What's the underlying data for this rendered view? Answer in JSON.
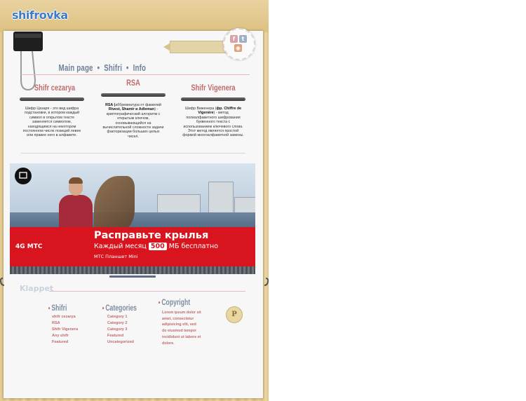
{
  "site": {
    "logo": "shifrovka"
  },
  "nav": {
    "items": [
      "Main page",
      "Shifri",
      "Info"
    ],
    "separator": "•"
  },
  "social": {
    "icons": [
      "facebook-icon",
      "twitter-icon",
      "rss-icon"
    ]
  },
  "columns": [
    {
      "title": "Shifr cezarya",
      "text": "Шифр Цезаря - это вид шифра подстановки, в котором каждый символ в открытом тексте заменяется символом, находящимся на некотором постоянном числе позиций левее или правее него в алфавите."
    },
    {
      "title": "RSA",
      "text_prefix": "RSA (",
      "text_abbr": "аббревиатура от фамилий",
      "names": "Rivest, Shamir и Adleman",
      "text_rest": ") - криптографический алгоритм с открытым ключом, основывающийся на вычислительной сложности задачи факторизации больших целых чисел."
    },
    {
      "title": "Shifr Vigenera",
      "text_prefix": "Шифр Виженера (",
      "text_lang": "фр.",
      "name": "Chiffre de Vigenère",
      "text_rest": ") - метод полиалфавитного шифрования буквенного текста с использованием ключевого слова. Этот метод является простой формой многоалфавитной замены."
    }
  ],
  "ad": {
    "headline": "Расправьте крылья",
    "sub_prefix": "Каждый месяц",
    "sub_number": "500",
    "sub_suffix": "МБ бесплатно",
    "product": "МТС Планшет Mini",
    "brand": "4G МТС"
  },
  "footer": {
    "logo": "Klappet",
    "shifri": {
      "title": "Shifri",
      "items": [
        "shifr cezarya",
        "RSA",
        "Shifr Vigenera",
        "Any shifr",
        "Featured"
      ]
    },
    "categories": {
      "title": "Categories",
      "items": [
        "Category 1",
        "Category 2",
        "Category 3",
        "Featured",
        "Uncategorized"
      ]
    },
    "copyright": {
      "title": "Copyright",
      "text": "Lorem ipsum dolor sit amet, consectetur adipisicing elit, sed do eiusmod tempor incididunt ut labore et dolore."
    },
    "seal": "P"
  },
  "colors": {
    "accent": "#c26b6b",
    "nav": "#6f7f9a",
    "ad_red": "#d8141f",
    "logo": "#3f79c7"
  }
}
